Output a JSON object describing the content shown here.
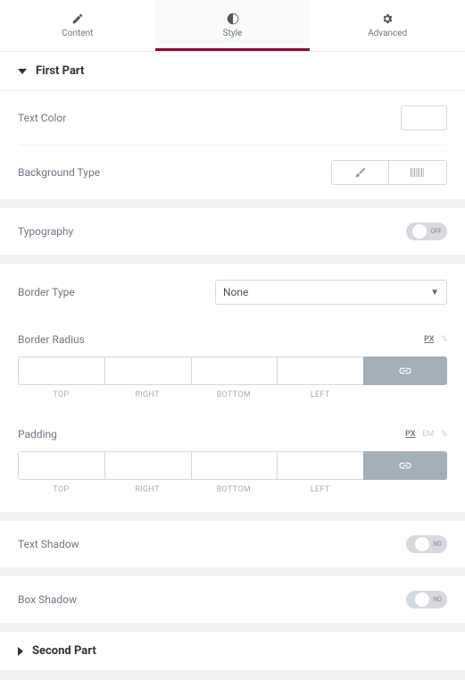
{
  "tabs": {
    "content": "Content",
    "style": "Style",
    "advanced": "Advanced"
  },
  "sections": {
    "first": "First Part",
    "second": "Second Part"
  },
  "labels": {
    "text_color": "Text Color",
    "bg_type": "Background Type",
    "typography": "Typography",
    "border_type": "Border Type",
    "border_radius": "Border Radius",
    "padding": "Padding",
    "text_shadow": "Text Shadow",
    "box_shadow": "Box Shadow"
  },
  "border_type_value": "None",
  "toggle": {
    "off": "OFF",
    "no": "NO"
  },
  "units": {
    "px": "PX",
    "em": "EM",
    "pct": "%"
  },
  "positions": {
    "top": "TOP",
    "right": "RIGHT",
    "bottom": "BOTTOM",
    "left": "LEFT"
  },
  "border_radius_vals": {
    "top": "",
    "right": "",
    "bottom": "",
    "left": ""
  },
  "padding_vals": {
    "top": "",
    "right": "",
    "bottom": "",
    "left": ""
  }
}
